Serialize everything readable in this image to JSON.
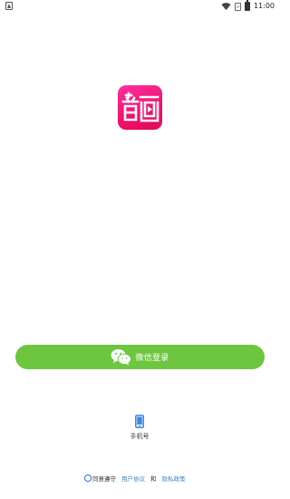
{
  "status_bar": {
    "time": "11:00",
    "icons": [
      "notification-a-icon",
      "wifi-icon",
      "no-sim-icon",
      "battery-icon"
    ]
  },
  "logo": {
    "icon": "yinhua-app-logo",
    "colors": {
      "bg_top": "#ff2fa0",
      "bg_bottom": "#e00a5a",
      "glyph": "#ffffff"
    }
  },
  "login": {
    "wechat_label": "微信登录",
    "wechat_color": "#6cc63e",
    "phone_label": "手机号"
  },
  "agreement": {
    "prefix": "同意遵守",
    "user_agreement": "用户协议",
    "and": "和",
    "privacy_policy": "隐私政策",
    "link_color": "#3a86c8"
  }
}
